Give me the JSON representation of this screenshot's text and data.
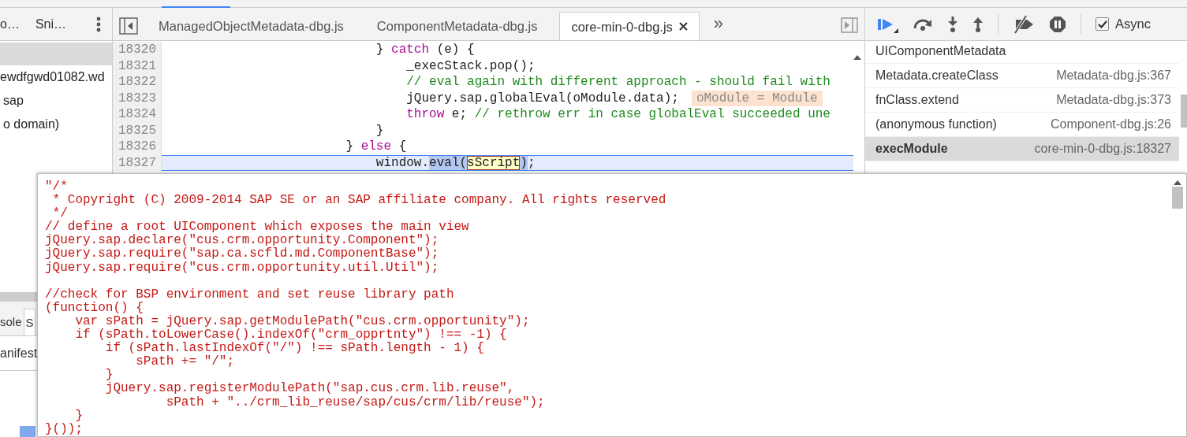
{
  "navigator": {
    "tabs": [
      {
        "label": "o…",
        "selected": false
      },
      {
        "label": "Sni…",
        "selected": false
      }
    ],
    "tree": [
      {
        "label": "ewdfgwd01082.wd"
      },
      {
        "label": "sap"
      },
      {
        "label": "o domain)"
      }
    ]
  },
  "drawer": {
    "tabs": [
      {
        "label": "sole",
        "selected": false
      },
      {
        "label": "S",
        "selected": true
      }
    ],
    "items": [
      {
        "label": "anifest"
      }
    ]
  },
  "editor": {
    "tabs": [
      {
        "label": "ManagedObjectMetadata-dbg.js",
        "selected": false,
        "closable": false
      },
      {
        "label": "ComponentMetadata-dbg.js",
        "selected": false,
        "closable": false
      },
      {
        "label": "core-min-0-dbg.js",
        "selected": true,
        "closable": true
      }
    ],
    "more_tabs": "»",
    "lines": [
      {
        "number": "18320",
        "current": false,
        "tokens": [
          {
            "kind": "plain",
            "text": "                            } "
          },
          {
            "kind": "keyword",
            "text": "catch"
          },
          {
            "kind": "plain",
            "text": " (e) {"
          }
        ]
      },
      {
        "number": "18321",
        "current": false,
        "tokens": [
          {
            "kind": "plain",
            "text": "                                _execStack.pop();"
          }
        ]
      },
      {
        "number": "18322",
        "current": false,
        "tokens": [
          {
            "kind": "comment",
            "text": "                                // eval again with different approach - should fail with"
          }
        ]
      },
      {
        "number": "18323",
        "current": false,
        "tokens": [
          {
            "kind": "plain",
            "text": "                                jQuery.sap.globalEval(oModule.data);"
          },
          {
            "kind": "inline-value",
            "text": "oModule = Module"
          }
        ]
      },
      {
        "number": "18324",
        "current": false,
        "tokens": [
          {
            "kind": "keyword",
            "text": "                                throw"
          },
          {
            "kind": "plain",
            "text": " e; "
          },
          {
            "kind": "comment",
            "text": "// rethrow err in case globalEval succeeded une"
          }
        ]
      },
      {
        "number": "18325",
        "current": false,
        "tokens": [
          {
            "kind": "plain",
            "text": "                            }"
          }
        ]
      },
      {
        "number": "18326",
        "current": false,
        "tokens": [
          {
            "kind": "plain",
            "text": "                        } "
          },
          {
            "kind": "keyword",
            "text": "else"
          },
          {
            "kind": "plain",
            "text": " {"
          }
        ]
      },
      {
        "number": "18327",
        "current": true,
        "tokens": [
          {
            "kind": "plain",
            "text": "                            window."
          },
          {
            "kind": "selection",
            "text": "eval("
          },
          {
            "kind": "hover",
            "text": "sScript"
          },
          {
            "kind": "selection",
            "text": ")"
          },
          {
            "kind": "plain",
            "text": ";"
          }
        ]
      }
    ]
  },
  "debugger": {
    "async": {
      "label": "Async",
      "checked": true
    },
    "call_stack": [
      {
        "function": "UIComponentMetadata",
        "selected": false
      },
      {
        "function": "Metadata.createClass",
        "location": "Metadata-dbg.js:367",
        "selected": false
      },
      {
        "function": "fnClass.extend",
        "location": "Metadata-dbg.js:373",
        "selected": false
      },
      {
        "function": "(anonymous function)",
        "location": "Component-dbg.js:26",
        "selected": false
      },
      {
        "function": "execModule",
        "location": "core-min-0-dbg.js:18327",
        "selected": true
      }
    ]
  },
  "popover": {
    "blocks": [
      [
        "\"/*",
        " * Copyright (C) 2009-2014 SAP SE or an SAP affiliate company. All rights reserved",
        " */",
        "// define a root UIComponent which exposes the main view",
        "jQuery.sap.declare(\"cus.crm.opportunity.Component\");",
        "jQuery.sap.require(\"sap.ca.scfld.md.ComponentBase\");",
        "jQuery.sap.require(\"cus.crm.opportunity.util.Util\");"
      ],
      [
        "//check for BSP environment and set reuse library path",
        "(function() {",
        "    var sPath = jQuery.sap.getModulePath(\"cus.crm.opportunity\");",
        "    if (sPath.toLowerCase().indexOf(\"crm_opprtnty\") !== -1) {",
        "        if (sPath.lastIndexOf(\"/\") !== sPath.length - 1) {",
        "            sPath += \"/\";",
        "        }",
        "        jQuery.sap.registerModulePath(\"sap.cus.crm.lib.reuse\",",
        "                sPath + \"../crm_lib_reuse/sap/cus/crm/lib/reuse\");",
        "    }",
        "}());"
      ]
    ]
  }
}
